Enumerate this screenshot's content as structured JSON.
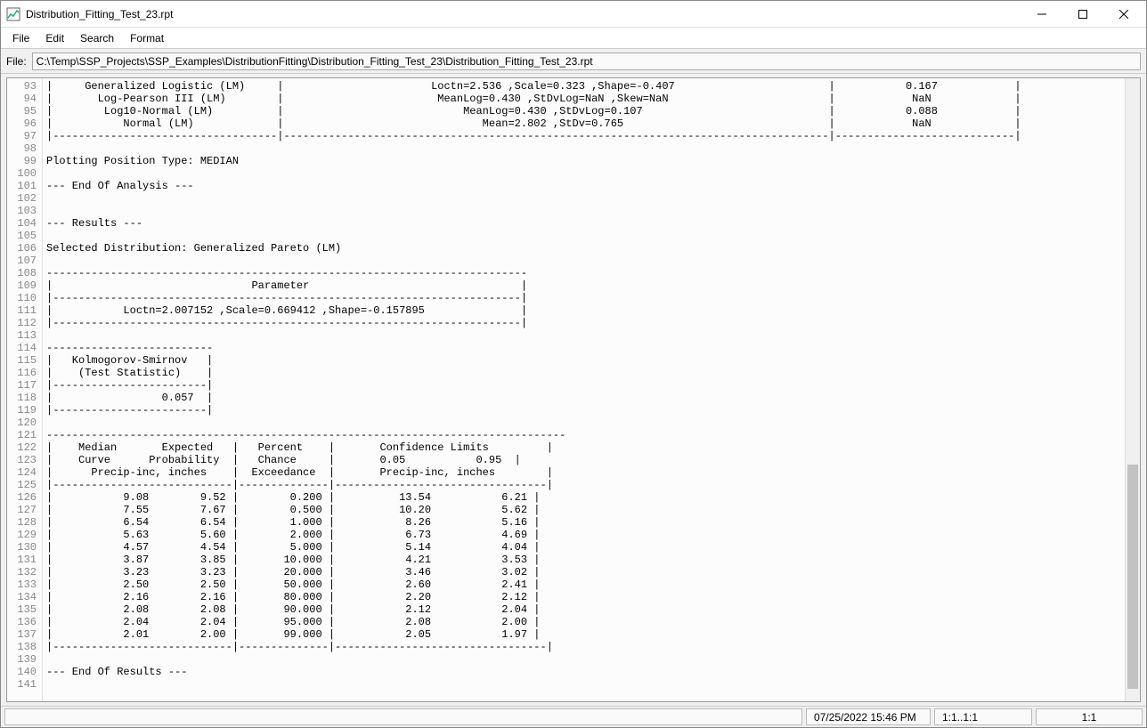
{
  "window": {
    "title": "Distribution_Fitting_Test_23.rpt"
  },
  "menubar": {
    "items": [
      "File",
      "Edit",
      "Search",
      "Format"
    ]
  },
  "filebar": {
    "label": "File:",
    "path": "C:\\Temp\\SSP_Projects\\SSP_Examples\\DistributionFitting\\Distribution_Fitting_Test_23\\Distribution_Fitting_Test_23.rpt"
  },
  "editor": {
    "first_line": 93,
    "last_line": 141,
    "lines": [
      "|     Generalized Logistic (LM)     |                       Loctn=2.536 ,Scale=0.323 ,Shape=-0.407                        |           0.167            |",
      "|       Log-Pearson III (LM)        |                        MeanLog=0.430 ,StDvLog=NaN ,Skew=NaN                         |            NaN             |",
      "|        Log10-Normal (LM)          |                            MeanLog=0.430 ,StDvLog=0.107                             |           0.088            |",
      "|           Normal (LM)             |                               Mean=2.802 ,StDv=0.765                                |            NaN             |",
      "|-----------------------------------|-------------------------------------------------------------------------------------|----------------------------|",
      "",
      "Plotting Position Type: MEDIAN",
      "",
      "--- End Of Analysis ---",
      "",
      "",
      "--- Results ---",
      "",
      "Selected Distribution: Generalized Pareto (LM)",
      "",
      "---------------------------------------------------------------------------",
      "|                               Parameter                                 |",
      "|-------------------------------------------------------------------------|",
      "|           Loctn=2.007152 ,Scale=0.669412 ,Shape=-0.157895               |",
      "|-------------------------------------------------------------------------|",
      "",
      "--------------------------",
      "|   Kolmogorov-Smirnov   |",
      "|    (Test Statistic)    |",
      "|------------------------|",
      "|                 0.057  |",
      "|------------------------|",
      "",
      "---------------------------------------------------------------------------------",
      "|    Median       Expected   |   Percent    |       Confidence Limits         |",
      "|    Curve      Probability  |   Chance     |       0.05           0.95  |",
      "|      Precip-inc, inches    |  Exceedance  |       Precip-inc, inches        |",
      "|----------------------------|--------------|---------------------------------|",
      "|           9.08        9.52 |        0.200 |          13.54           6.21 |",
      "|           7.55        7.67 |        0.500 |          10.20           5.62 |",
      "|           6.54        6.54 |        1.000 |           8.26           5.16 |",
      "|           5.63        5.60 |        2.000 |           6.73           4.69 |",
      "|           4.57        4.54 |        5.000 |           5.14           4.04 |",
      "|           3.87        3.85 |       10.000 |           4.21           3.53 |",
      "|           3.23        3.23 |       20.000 |           3.46           3.02 |",
      "|           2.50        2.50 |       50.000 |           2.60           2.41 |",
      "|           2.16        2.16 |       80.000 |           2.20           2.12 |",
      "|           2.08        2.08 |       90.000 |           2.12           2.04 |",
      "|           2.04        2.04 |       95.000 |           2.08           2.00 |",
      "|           2.01        2.00 |       99.000 |           2.05           1.97 |",
      "|----------------------------|--------------|---------------------------------|",
      "",
      "--- End Of Results ---",
      ""
    ]
  },
  "statusbar": {
    "timestamp": "07/25/2022 15:46 PM",
    "cursor": "1:1..1:1",
    "extra": "1:1"
  },
  "scroll": {
    "thumb_top_pct": 62,
    "thumb_height_pct": 36
  }
}
